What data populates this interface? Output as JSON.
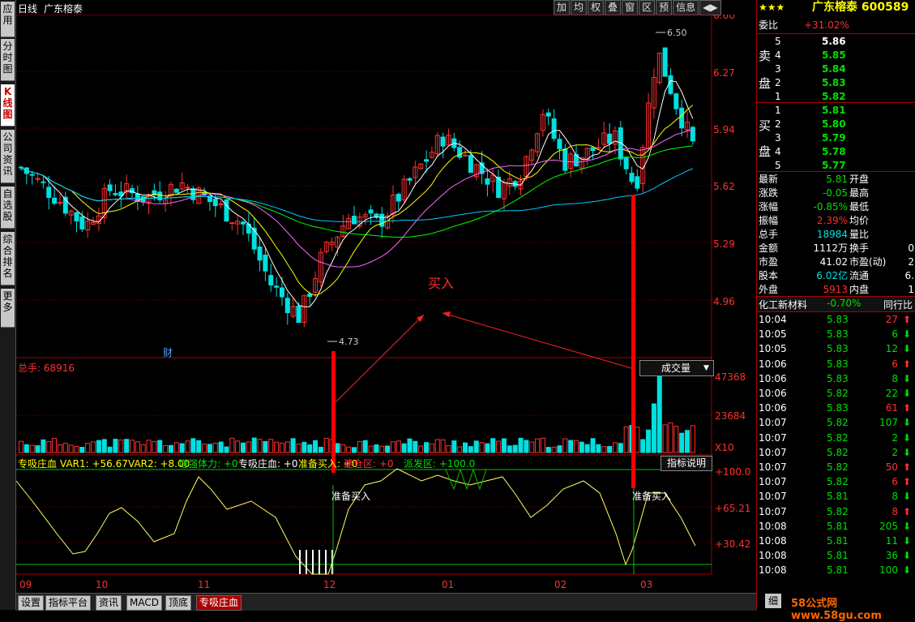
{
  "left_tabs": [
    "应用",
    "分时图",
    "K线图",
    "公司资讯",
    "自选股",
    "综合排名",
    "更多"
  ],
  "chart": {
    "period": "日线",
    "stock_name": "广东榕泰",
    "price_ticks": [
      "6.60",
      "6.27",
      "5.94",
      "5.62",
      "5.29",
      "4.96"
    ],
    "high_label": "6.50",
    "low_label": "4.73",
    "cai_mark": "财",
    "buy_annotation": "买入",
    "volume_label": "总手: 68916",
    "volume_selector": "成交量",
    "volume_ticks": [
      "47368",
      "23684",
      "X10"
    ],
    "indicator_line": {
      "name": "专吸庄血",
      "var1": "VAR1: +56.67",
      "var2": "VAR2: +8.00",
      "zqtl": "增强体力: +0",
      "zxzx": "专吸庄血: +0",
      "zbmr": "准备买入: +0",
      "jcq": "建仓区: +0",
      "pfq": "派发区: +100.0"
    },
    "indicator_help": "指标说明",
    "indicator_ticks": [
      "+100.0",
      "+65.21",
      "+30.42"
    ],
    "prep_buy_label": "准备买入",
    "months": [
      "09",
      "10",
      "11",
      "12",
      "01",
      "02",
      "03"
    ]
  },
  "toolbar": [
    "加",
    "均",
    "权",
    "叠",
    "窗",
    "区",
    "预",
    "信息",
    "◀▶"
  ],
  "bottom_tabs": [
    "设置",
    "指标平台",
    "资讯",
    "MACD",
    "顶底",
    "专吸庄血"
  ],
  "quote": {
    "title": "广东榕泰 600589",
    "weibi_label": "委比",
    "weibi_value": "+31.02%",
    "sell_label": [
      "卖",
      "盘"
    ],
    "buy_label": [
      "买",
      "盘"
    ],
    "asks": [
      {
        "lvl": "5",
        "price": "5.86"
      },
      {
        "lvl": "4",
        "price": "5.85"
      },
      {
        "lvl": "3",
        "price": "5.84"
      },
      {
        "lvl": "2",
        "price": "5.83"
      },
      {
        "lvl": "1",
        "price": "5.82"
      }
    ],
    "bids": [
      {
        "lvl": "1",
        "price": "5.81"
      },
      {
        "lvl": "2",
        "price": "5.80"
      },
      {
        "lvl": "3",
        "price": "5.79"
      },
      {
        "lvl": "4",
        "price": "5.78"
      },
      {
        "lvl": "5",
        "price": "5.77"
      }
    ],
    "stats": [
      {
        "k": "最新",
        "v": "5.81",
        "k2": "开盘"
      },
      {
        "k": "涨跌",
        "v": "-0.05",
        "k2": "最高"
      },
      {
        "k": "涨幅",
        "v": "-0.85%",
        "k2": "最低"
      },
      {
        "k": "振幅",
        "v": "2.39%",
        "k2": "均价"
      },
      {
        "k": "总手",
        "v": "18984",
        "k2": "量比"
      },
      {
        "k": "金额",
        "v": "1112万",
        "k2": "换手",
        "v2": "0"
      },
      {
        "k": "市盈",
        "v": "41.02",
        "k2": "市盈(动)",
        "v2": "2"
      },
      {
        "k": "股本",
        "v": "6.02亿",
        "k2": "流通",
        "v2": "6."
      },
      {
        "k": "外盘",
        "v": "5913",
        "k2": "内盘",
        "v2": "1"
      }
    ],
    "sector": "化工新材料",
    "sector_change": "-0.70%",
    "sector_extra": "同行比",
    "ticks": [
      {
        "t": "10:04",
        "p": "5.83",
        "v": "27",
        "d": "up"
      },
      {
        "t": "10:05",
        "p": "5.83",
        "v": "6",
        "d": "down"
      },
      {
        "t": "10:05",
        "p": "5.83",
        "v": "12",
        "d": "down"
      },
      {
        "t": "10:06",
        "p": "5.83",
        "v": "6",
        "d": "up"
      },
      {
        "t": "10:06",
        "p": "5.83",
        "v": "8",
        "d": "down"
      },
      {
        "t": "10:06",
        "p": "5.82",
        "v": "22",
        "d": "down"
      },
      {
        "t": "10:06",
        "p": "5.83",
        "v": "61",
        "d": "up"
      },
      {
        "t": "10:07",
        "p": "5.82",
        "v": "107",
        "d": "down"
      },
      {
        "t": "10:07",
        "p": "5.82",
        "v": "2",
        "d": "down"
      },
      {
        "t": "10:07",
        "p": "5.82",
        "v": "2",
        "d": "down"
      },
      {
        "t": "10:07",
        "p": "5.82",
        "v": "50",
        "d": "up"
      },
      {
        "t": "10:07",
        "p": "5.82",
        "v": "6",
        "d": "up"
      },
      {
        "t": "10:07",
        "p": "5.81",
        "v": "8",
        "d": "down"
      },
      {
        "t": "10:07",
        "p": "5.82",
        "v": "8",
        "d": "up"
      },
      {
        "t": "10:08",
        "p": "5.81",
        "v": "205",
        "d": "down"
      },
      {
        "t": "10:08",
        "p": "5.81",
        "v": "11",
        "d": "down"
      },
      {
        "t": "10:08",
        "p": "5.81",
        "v": "36",
        "d": "down"
      },
      {
        "t": "10:08",
        "p": "5.81",
        "v": "100",
        "d": "down"
      }
    ],
    "detail_tab": "细",
    "watermark": "58公式网 www.58gu.com"
  },
  "colors": {
    "up": "#ff3030",
    "down": "#00e0e0",
    "grid": "#8b0000",
    "ma5": "#ffffff",
    "ma10": "#ffff00",
    "ma20": "#ff66ff",
    "ma60": "#00ff00",
    "ma120": "#00ccff"
  }
}
